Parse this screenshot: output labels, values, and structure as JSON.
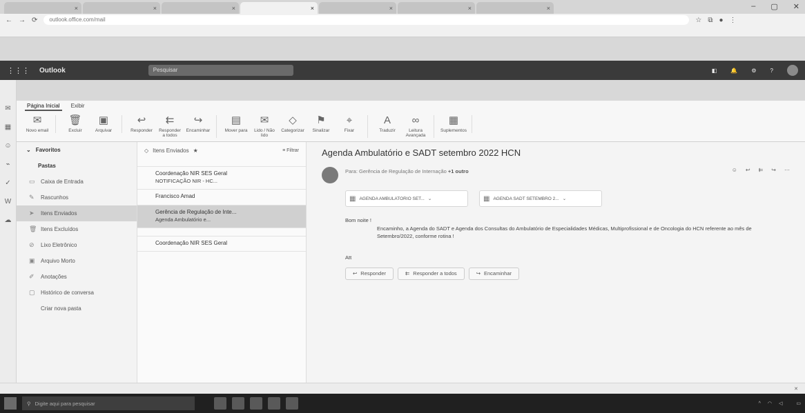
{
  "browser": {
    "tabs": [
      {
        "label": "",
        "active": false
      },
      {
        "label": "",
        "active": false
      },
      {
        "label": "",
        "active": false
      },
      {
        "label": "",
        "active": true
      },
      {
        "label": "",
        "active": false
      },
      {
        "label": "",
        "active": false
      },
      {
        "label": "",
        "active": false
      }
    ],
    "url": "outlook.office.com/mail",
    "window_controls": {
      "minimize": "–",
      "maximize": "▢",
      "close": "✕"
    },
    "nav": {
      "back": "←",
      "forward": "→",
      "reload": "⟳"
    },
    "bookmarks": [
      "",
      "",
      "",
      "",
      "",
      "",
      "",
      "",
      "",
      ""
    ]
  },
  "outlook": {
    "brand": "Outlook",
    "search_placeholder": "Pesquisar"
  },
  "ribbon": {
    "tabs": [
      "Página Inicial",
      "Exibir"
    ],
    "buttons": [
      {
        "icon": "mail-new-icon",
        "glyph": "✉",
        "label": "Novo email"
      },
      {
        "icon": "delete-icon",
        "glyph": "🗑",
        "label": "Excluir"
      },
      {
        "icon": "archive-icon",
        "glyph": "▣",
        "label": "Arquivar"
      },
      {
        "icon": "reply-icon",
        "glyph": "↩",
        "label": "Responder"
      },
      {
        "icon": "reply-all-icon",
        "glyph": "⇇",
        "label": "Responder a todos"
      },
      {
        "icon": "forward-icon",
        "glyph": "↪",
        "label": "Encaminhar"
      },
      {
        "icon": "move-icon",
        "glyph": "▤",
        "label": "Mover para"
      },
      {
        "icon": "read-icon",
        "glyph": "✉",
        "label": "Lido / Não lido"
      },
      {
        "icon": "tag-icon",
        "glyph": "◇",
        "label": "Categorizar"
      },
      {
        "icon": "flag-icon",
        "glyph": "⚑",
        "label": "Sinalizar"
      },
      {
        "icon": "pin-icon",
        "glyph": "⌖",
        "label": "Fixar"
      },
      {
        "icon": "translate-icon",
        "glyph": "A",
        "label": "Traduzir"
      },
      {
        "icon": "reader-icon",
        "glyph": "∞",
        "label": "Leitura Avançada"
      },
      {
        "icon": "addins-icon",
        "glyph": "▦",
        "label": "Suplementos"
      }
    ]
  },
  "folders": {
    "header": "Favoritos",
    "items": [
      {
        "label": "Pastas",
        "icon": "",
        "count": "",
        "header": true,
        "selected": false
      },
      {
        "label": "Caixa de Entrada",
        "icon": "▭",
        "count": "",
        "header": false,
        "selected": false
      },
      {
        "label": "Rascunhos",
        "icon": "✎",
        "count": "",
        "header": false,
        "selected": false
      },
      {
        "label": "Itens Enviados",
        "icon": "➤",
        "count": "",
        "header": false,
        "selected": true
      },
      {
        "label": "Itens Excluídos",
        "icon": "🗑",
        "count": "",
        "header": false,
        "selected": false
      },
      {
        "label": "Lixo Eletrônico",
        "icon": "⊘",
        "count": "",
        "header": false,
        "selected": false
      },
      {
        "label": "Arquivo Morto",
        "icon": "▣",
        "count": "",
        "header": false,
        "selected": false
      },
      {
        "label": "Anotações",
        "icon": "✐",
        "count": "",
        "header": false,
        "selected": false
      },
      {
        "label": "Histórico de conversa",
        "icon": "▢",
        "count": "",
        "header": false,
        "selected": false
      },
      {
        "label": "Criar nova pasta",
        "icon": "",
        "count": "",
        "header": false,
        "selected": false
      }
    ]
  },
  "message_list": {
    "title": "Itens Enviados",
    "filter": "Filtrar",
    "messages": [
      {
        "from": "",
        "subject": "",
        "date": "",
        "preview": "",
        "chip": "",
        "selected": false
      },
      {
        "from": "Coordenação NIR SES Geral",
        "subject": "NOTIFICAÇÃO NIR - HC...",
        "date": "",
        "preview": "",
        "chip": "",
        "selected": false
      },
      {
        "from": "Francisco Amad",
        "subject": "",
        "date": "",
        "preview": "",
        "chip": "",
        "selected": false
      },
      {
        "from": "Gerência de Regulação de Inte...",
        "subject": "Agenda Ambulatório e...",
        "date": "",
        "preview": "",
        "chip": "",
        "selected": true
      },
      {
        "from": "",
        "subject": "",
        "date": "",
        "preview": "",
        "chip": "",
        "selected": false
      },
      {
        "from": "Coordenação NIR SES Geral",
        "subject": "",
        "date": "",
        "preview": "",
        "chip": "",
        "selected": false
      }
    ]
  },
  "reading": {
    "subject": "Agenda Ambulatório e SADT setembro 2022 HCN",
    "toolbar": "",
    "sender_initials": "",
    "sender_name": "",
    "recipients_label": "Para:",
    "recipients": "Gerência de Regulação de Internação",
    "more_recipients": "+1 outro",
    "sender_tools": [
      "",
      "",
      "",
      ""
    ],
    "attachments": [
      {
        "name": "AGENDA AMBULATORIO SET...",
        "size": ""
      },
      {
        "name": "AGENDA SADT SETEMBRO 2...",
        "size": ""
      }
    ],
    "attachments_meta": "",
    "greeting": "Bom noite !",
    "body": "Encaminho, a Agenda do SADT e Agenda dos Consultas do Ambulatório de Especialidades Médicas, Multiprofissional e de Oncologia do HCN referente ao mês de Setembro/2022, conforme rotina !",
    "signature": "Att",
    "actions": [
      {
        "glyph": "↩",
        "label": "Responder"
      },
      {
        "glyph": "⇇",
        "label": "Responder a todos"
      },
      {
        "glyph": "↪",
        "label": "Encaminhar"
      }
    ]
  },
  "status": {
    "left": "",
    "right": ""
  },
  "taskbar": {
    "search": "Digite aqui para pesquisar",
    "time": "",
    "date": ""
  }
}
